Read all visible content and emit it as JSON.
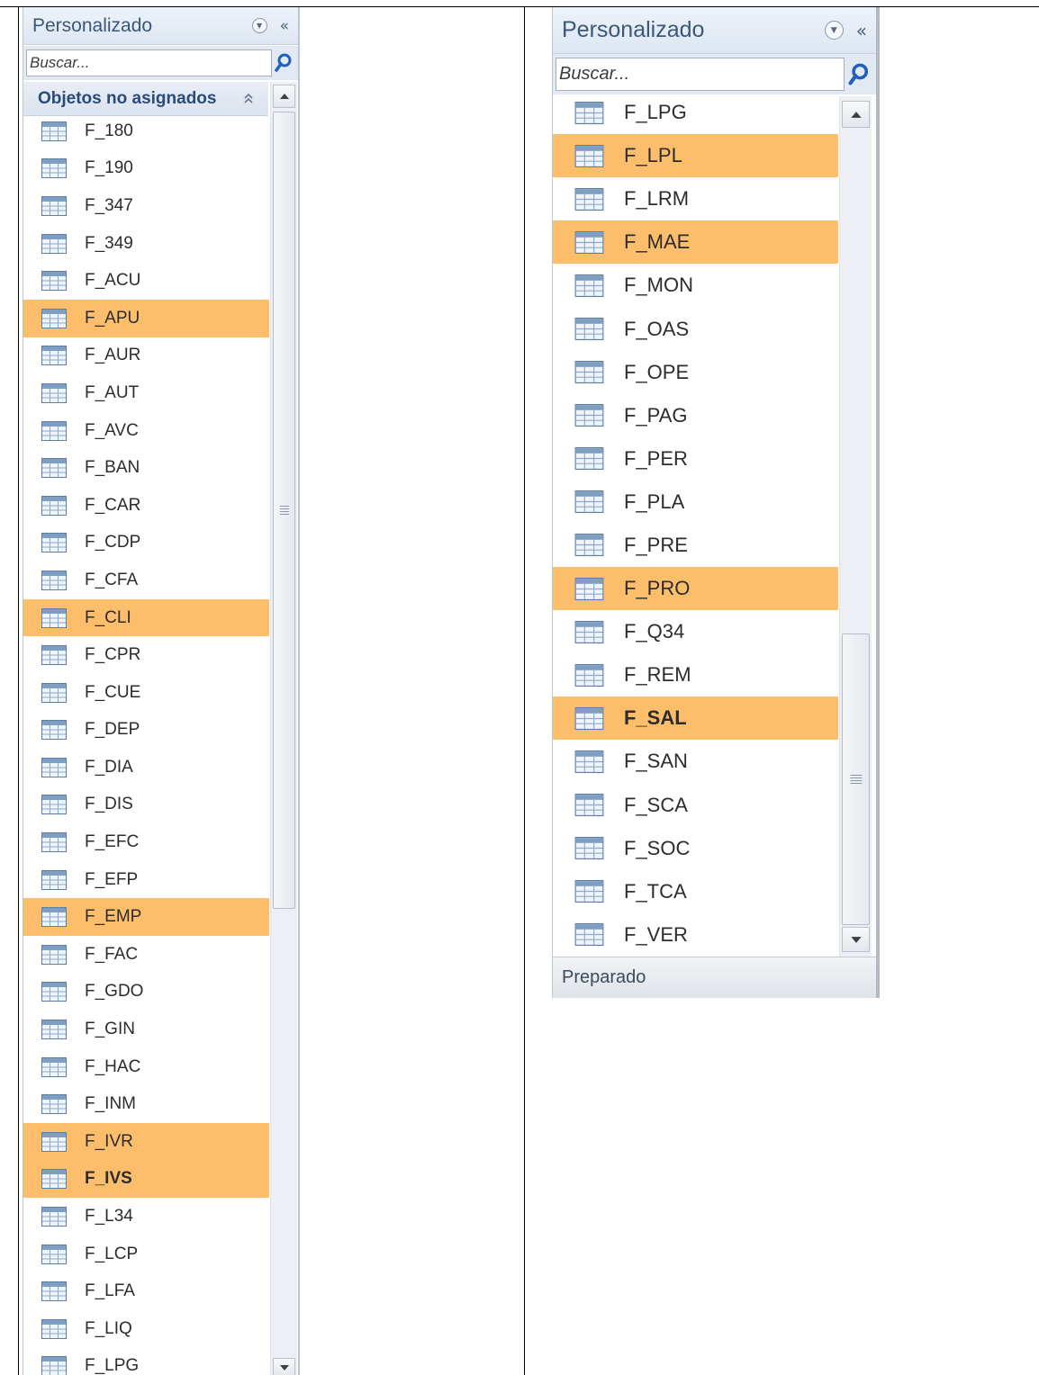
{
  "left_pane": {
    "title": "Personalizado",
    "search_placeholder": "Buscar...",
    "group_label": "Objetos no asignados",
    "items": [
      {
        "label": "F_180",
        "selected": false,
        "bold": false
      },
      {
        "label": "F_190",
        "selected": false,
        "bold": false
      },
      {
        "label": "F_347",
        "selected": false,
        "bold": false
      },
      {
        "label": "F_349",
        "selected": false,
        "bold": false
      },
      {
        "label": "F_ACU",
        "selected": false,
        "bold": false
      },
      {
        "label": "F_APU",
        "selected": true,
        "bold": false
      },
      {
        "label": "F_AUR",
        "selected": false,
        "bold": false
      },
      {
        "label": "F_AUT",
        "selected": false,
        "bold": false
      },
      {
        "label": "F_AVC",
        "selected": false,
        "bold": false
      },
      {
        "label": "F_BAN",
        "selected": false,
        "bold": false
      },
      {
        "label": "F_CAR",
        "selected": false,
        "bold": false
      },
      {
        "label": "F_CDP",
        "selected": false,
        "bold": false
      },
      {
        "label": "F_CFA",
        "selected": false,
        "bold": false
      },
      {
        "label": "F_CLI",
        "selected": true,
        "bold": false
      },
      {
        "label": "F_CPR",
        "selected": false,
        "bold": false
      },
      {
        "label": "F_CUE",
        "selected": false,
        "bold": false
      },
      {
        "label": "F_DEP",
        "selected": false,
        "bold": false
      },
      {
        "label": "F_DIA",
        "selected": false,
        "bold": false
      },
      {
        "label": "F_DIS",
        "selected": false,
        "bold": false
      },
      {
        "label": "F_EFC",
        "selected": false,
        "bold": false
      },
      {
        "label": "F_EFP",
        "selected": false,
        "bold": false
      },
      {
        "label": "F_EMP",
        "selected": true,
        "bold": false
      },
      {
        "label": "F_FAC",
        "selected": false,
        "bold": false
      },
      {
        "label": "F_GDO",
        "selected": false,
        "bold": false
      },
      {
        "label": "F_GIN",
        "selected": false,
        "bold": false
      },
      {
        "label": "F_HAC",
        "selected": false,
        "bold": false
      },
      {
        "label": "F_INM",
        "selected": false,
        "bold": false
      },
      {
        "label": "F_IVR",
        "selected": true,
        "bold": false
      },
      {
        "label": "F_IVS",
        "selected": true,
        "bold": true
      },
      {
        "label": "F_L34",
        "selected": false,
        "bold": false
      },
      {
        "label": "F_LCP",
        "selected": false,
        "bold": false
      },
      {
        "label": "F_LFA",
        "selected": false,
        "bold": false
      },
      {
        "label": "F_LIQ",
        "selected": false,
        "bold": false
      },
      {
        "label": "F_LPG",
        "selected": false,
        "bold": false
      }
    ]
  },
  "right_pane": {
    "title": "Personalizado",
    "search_placeholder": "Buscar...",
    "items": [
      {
        "label": "F_LPG",
        "selected": false,
        "bold": false
      },
      {
        "label": "F_LPL",
        "selected": true,
        "bold": false
      },
      {
        "label": "F_LRM",
        "selected": false,
        "bold": false
      },
      {
        "label": "F_MAE",
        "selected": true,
        "bold": false
      },
      {
        "label": "F_MON",
        "selected": false,
        "bold": false
      },
      {
        "label": "F_OAS",
        "selected": false,
        "bold": false
      },
      {
        "label": "F_OPE",
        "selected": false,
        "bold": false
      },
      {
        "label": "F_PAG",
        "selected": false,
        "bold": false
      },
      {
        "label": "F_PER",
        "selected": false,
        "bold": false
      },
      {
        "label": "F_PLA",
        "selected": false,
        "bold": false
      },
      {
        "label": "F_PRE",
        "selected": false,
        "bold": false
      },
      {
        "label": "F_PRO",
        "selected": true,
        "bold": false
      },
      {
        "label": "F_Q34",
        "selected": false,
        "bold": false
      },
      {
        "label": "F_REM",
        "selected": false,
        "bold": false
      },
      {
        "label": "F_SAL",
        "selected": true,
        "bold": true
      },
      {
        "label": "F_SAN",
        "selected": false,
        "bold": false
      },
      {
        "label": "F_SCA",
        "selected": false,
        "bold": false
      },
      {
        "label": "F_SOC",
        "selected": false,
        "bold": false
      },
      {
        "label": "F_TCA",
        "selected": false,
        "bold": false
      },
      {
        "label": "F_VER",
        "selected": false,
        "bold": false
      }
    ],
    "status_text": "Preparado"
  },
  "icons": {
    "table": "table-icon",
    "dropdown": "chevron-down-circle-icon",
    "collapse_pane": "double-chevron-left-icon",
    "collapse_group": "double-chevron-up-icon",
    "search": "search-icon",
    "scroll_up": "scroll-up-arrow-icon",
    "scroll_down": "scroll-down-arrow-icon"
  },
  "colors": {
    "selected_row": "#fdbe6c",
    "header_title": "#3b5779",
    "group_label": "#2a4b7a",
    "search_icon": "#1f5fbf"
  }
}
